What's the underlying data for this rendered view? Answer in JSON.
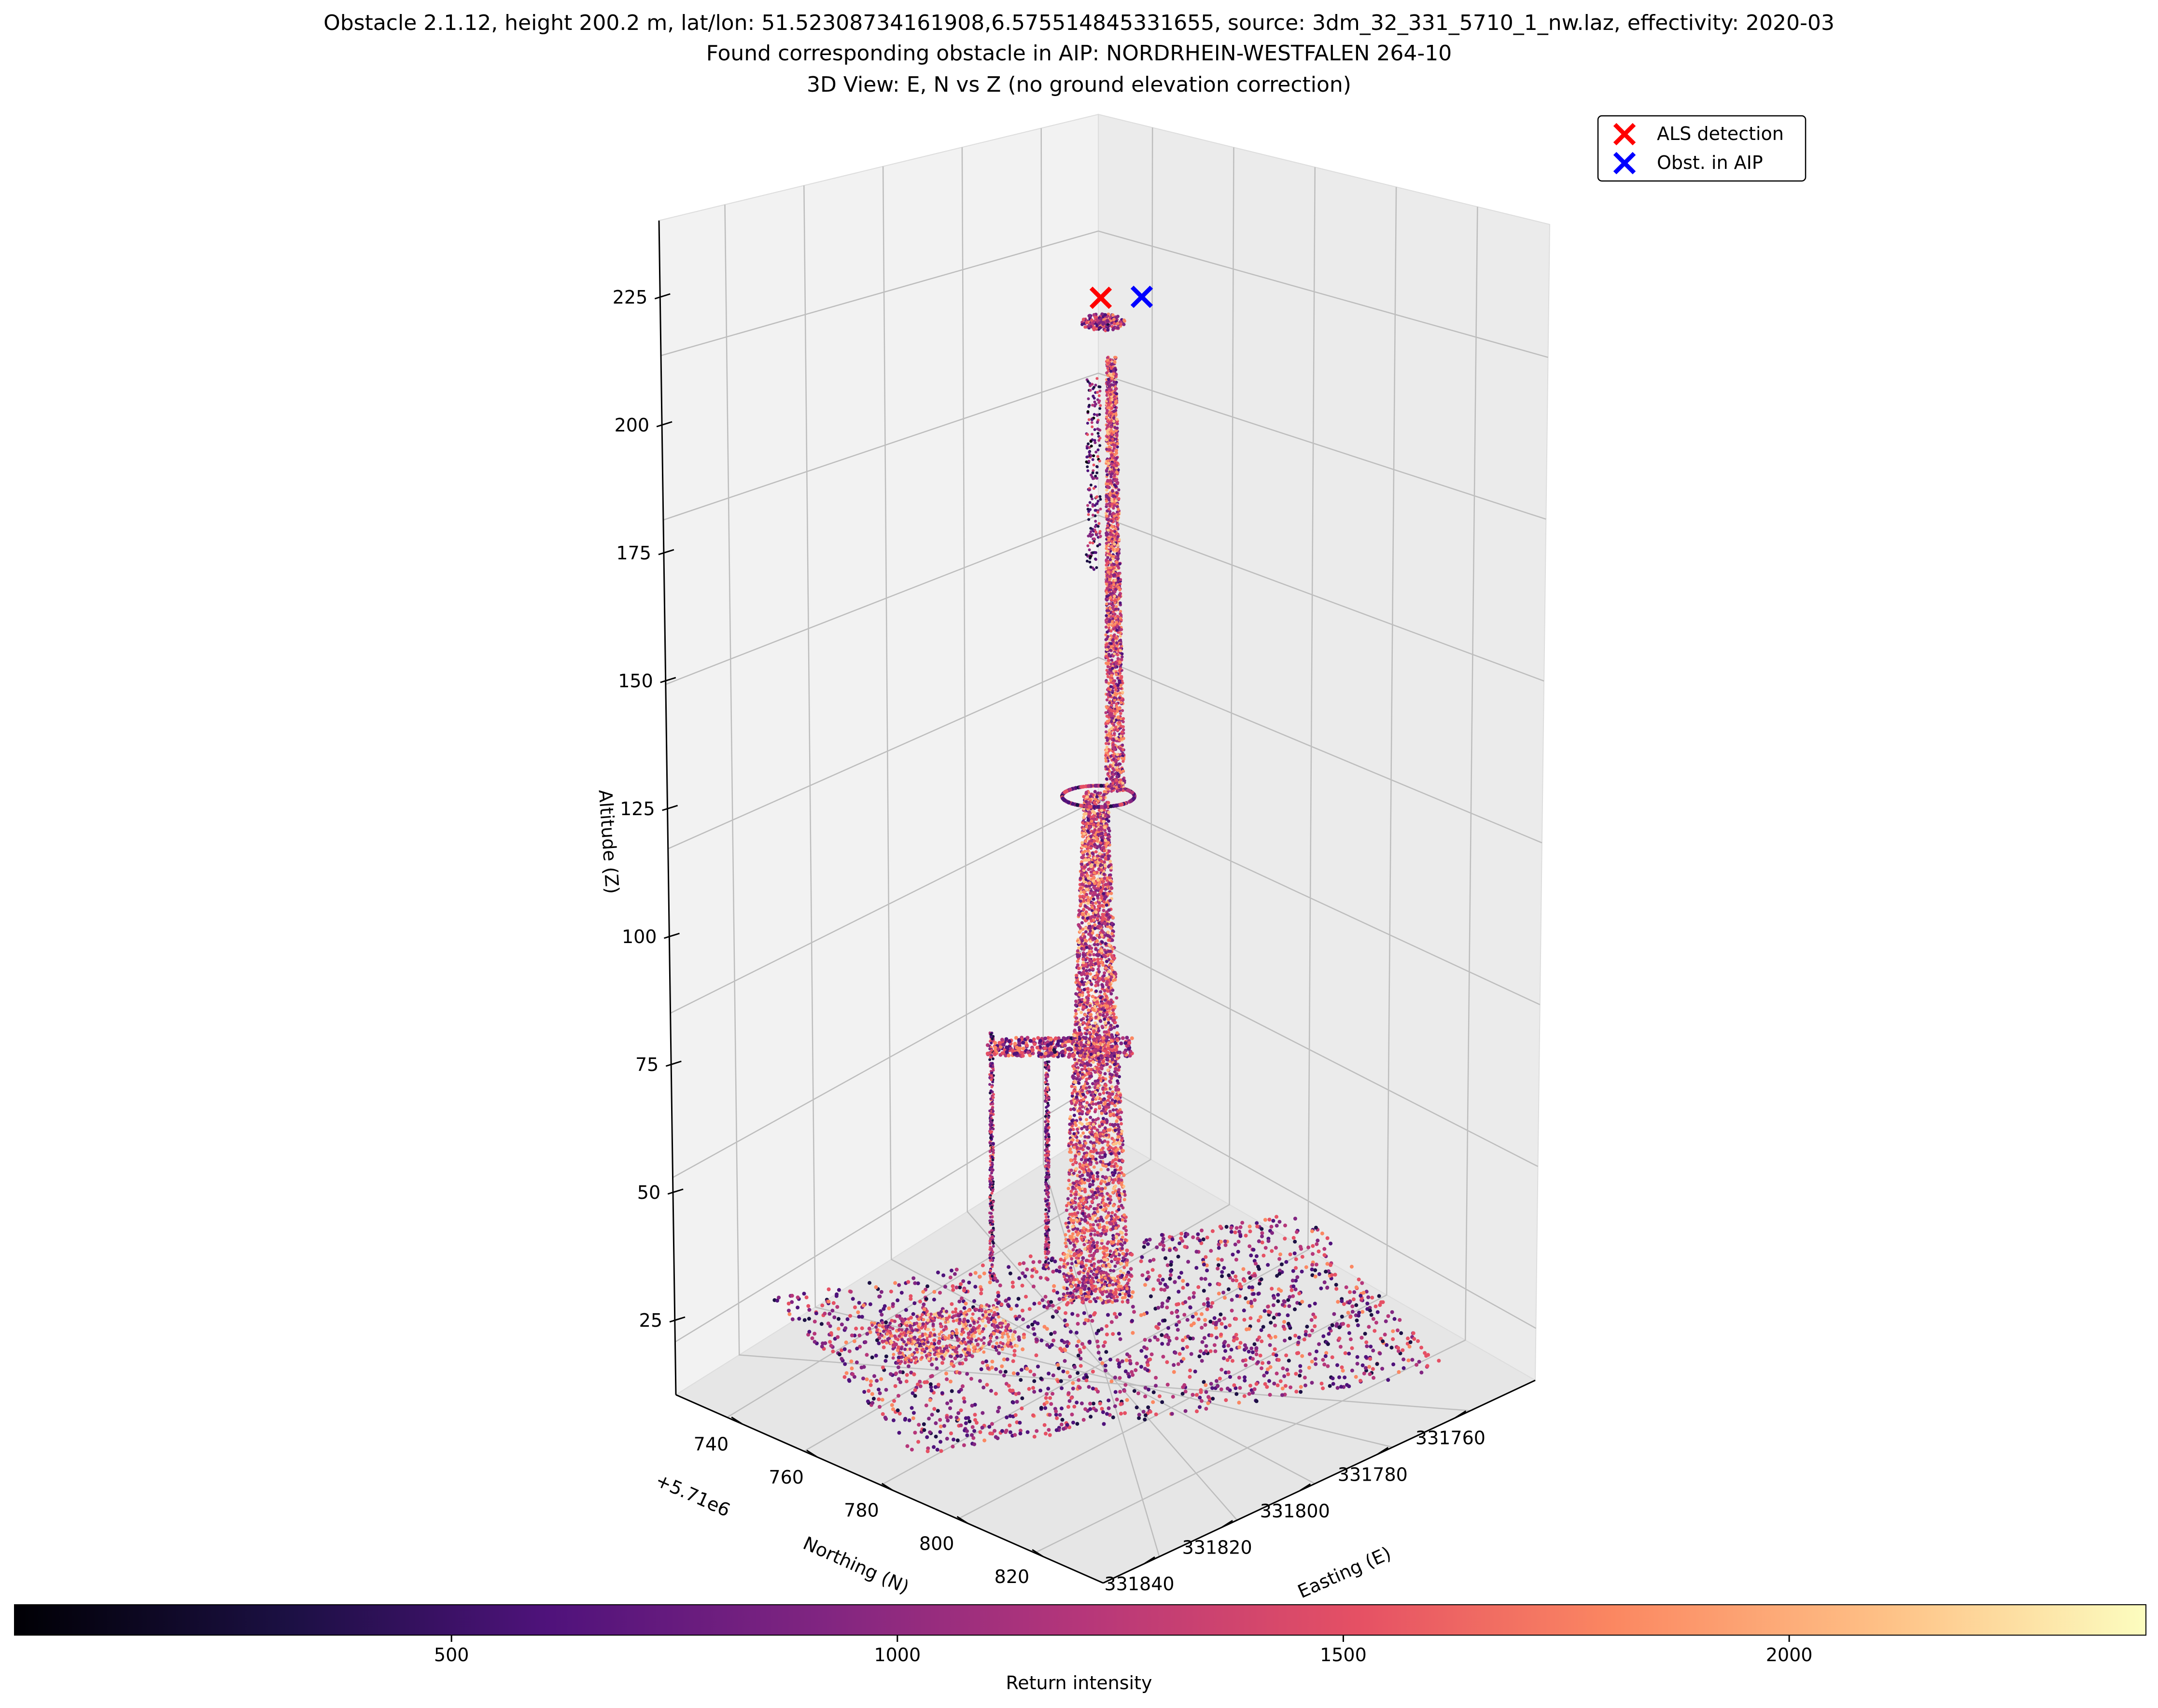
{
  "chart_data": {
    "type": "scatter",
    "projection": "3d",
    "title_lines": [
      "Obstacle 2.1.12, height 200.2 m, lat/lon: 51.52308734161908,6.575514845331655, source: 3dm_32_331_5710_1_nw.laz, effectivity: 2020-03",
      "Found corresponding obstacle in AIP: NORDRHEIN-WESTFALEN 264-10",
      "3D View: E, N vs Z (no ground elevation correction)"
    ],
    "xlabel": "Easting (E)",
    "ylabel": "Northing (N)",
    "ylabel_offset": "+5.71e6",
    "zlabel": "Altitude (Z)",
    "x_ticks": [
      "331760",
      "331780",
      "331800",
      "331820",
      "331840"
    ],
    "y_ticks": [
      "740",
      "760",
      "780",
      "800",
      "820"
    ],
    "z_ticks": [
      "25",
      "50",
      "75",
      "100",
      "125",
      "150",
      "175",
      "200",
      "225"
    ],
    "grid": true,
    "legend_placement": "top-right",
    "series": [
      {
        "name": "ALS detection",
        "marker": "x",
        "color": "#ff0000",
        "z": 226
      },
      {
        "name": "Obst. in AIP",
        "marker": "x",
        "color": "#0000ff",
        "z": 226
      }
    ],
    "point_cloud": {
      "description_colormap": "magma",
      "tower_base_z": 20,
      "tower_platform_z": 127,
      "tower_top_z": 215,
      "antenna_cap_z": 224,
      "structure_deck_z": 80
    },
    "colorbar": {
      "label": "Return intensity",
      "ticks": [
        "500",
        "1000",
        "1500",
        "2000"
      ],
      "tick_values": [
        500,
        1000,
        1500,
        2000
      ],
      "min": 10,
      "max": 2400,
      "colormap": "magma"
    }
  }
}
